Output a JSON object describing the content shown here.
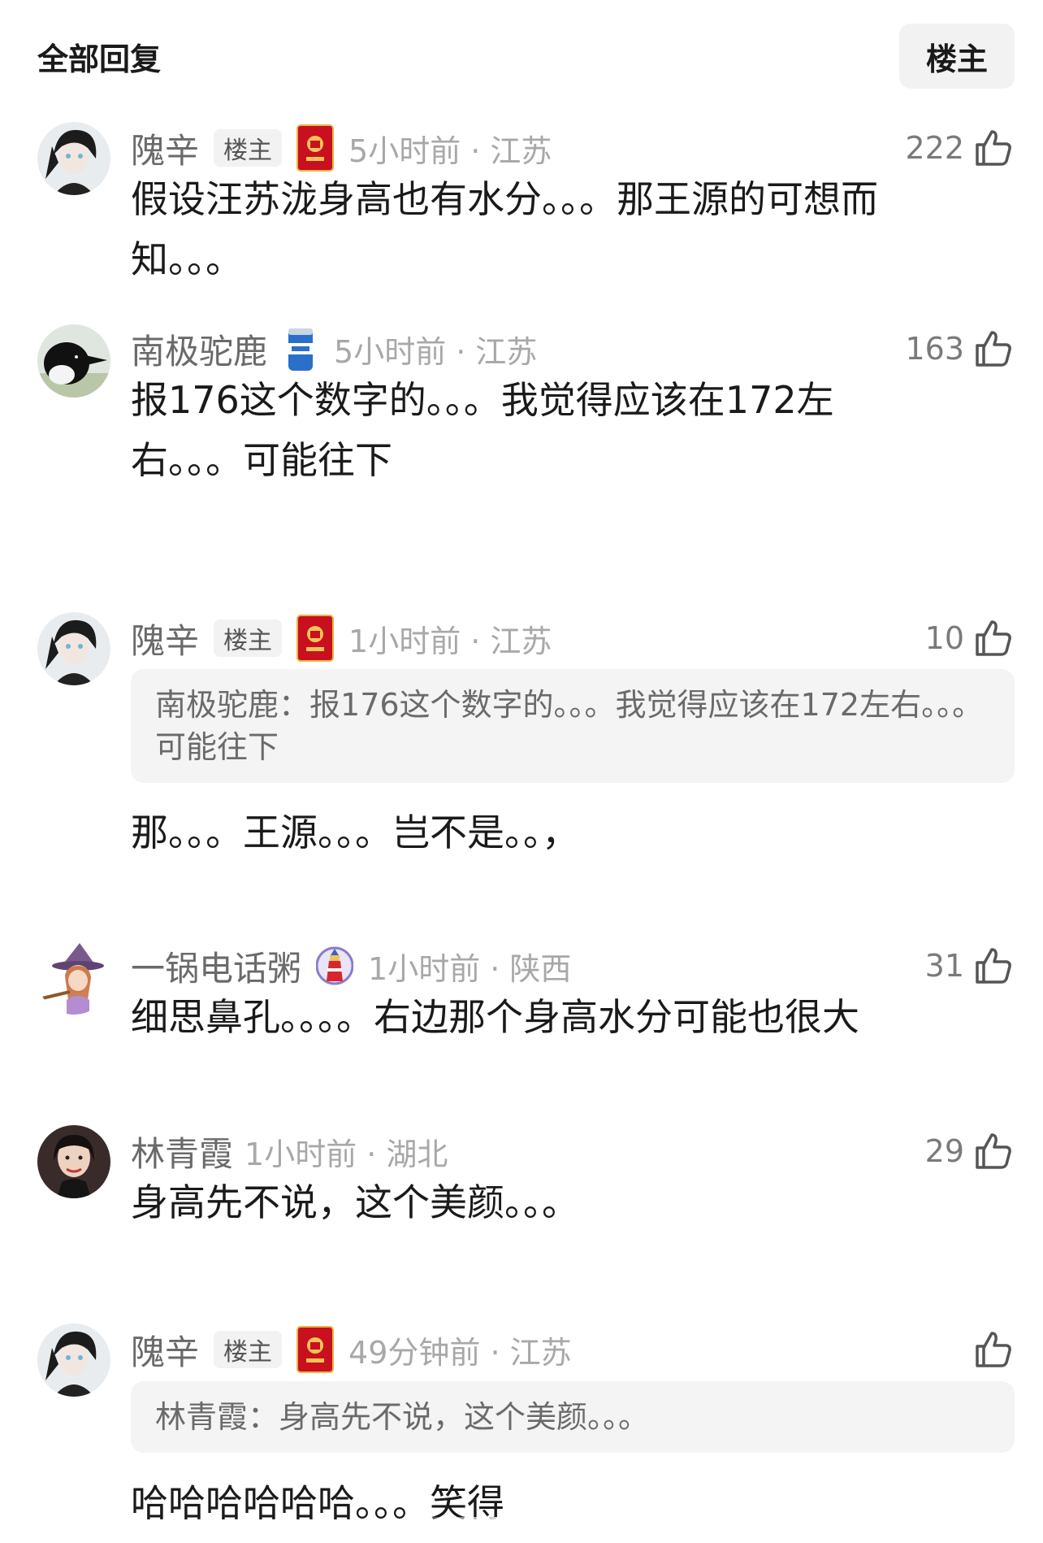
{
  "header": {
    "title": "全部回复",
    "op_filter": "楼主"
  },
  "comments": [
    {
      "user": "隗辛",
      "op_tag": "楼主",
      "time": "5小时前 · 江苏",
      "likes": "222",
      "text": "假设汪苏泷身高也有水分。。。那王源的可想而知。。。",
      "quote_author": "",
      "quote_text": ""
    },
    {
      "user": "南极驼鹿",
      "op_tag": "",
      "time": "5小时前 · 江苏",
      "likes": "163",
      "text": "报176这个数字的。。。我觉得应该在172左右。。。可能往下",
      "quote_author": "",
      "quote_text": ""
    },
    {
      "user": "隗辛",
      "op_tag": "楼主",
      "time": "1小时前 · 江苏",
      "likes": "10",
      "text": "那。。。王源。。。岂不是。。，",
      "quote_author": "南极驼鹿：",
      "quote_text": "报176这个数字的。。。我觉得应该在172左右。。。可能往下"
    },
    {
      "user": "一锅电话粥",
      "op_tag": "",
      "time": "1小时前 · 陕西",
      "likes": "31",
      "text": "细思鼻孔。。。。右边那个身高水分可能也很大",
      "quote_author": "",
      "quote_text": ""
    },
    {
      "user": "林青霞",
      "op_tag": "",
      "time": "1小时前 · 湖北",
      "likes": "29",
      "text": "身高先不说，这个美颜。。。",
      "quote_author": "",
      "quote_text": ""
    },
    {
      "user": "隗辛",
      "op_tag": "楼主",
      "time": "49分钟前 · 江苏",
      "likes": "",
      "text": "哈哈哈哈哈哈。。。笑得",
      "quote_author": "林青霞：",
      "quote_text": "身高先不说，这个美颜。。。"
    }
  ]
}
